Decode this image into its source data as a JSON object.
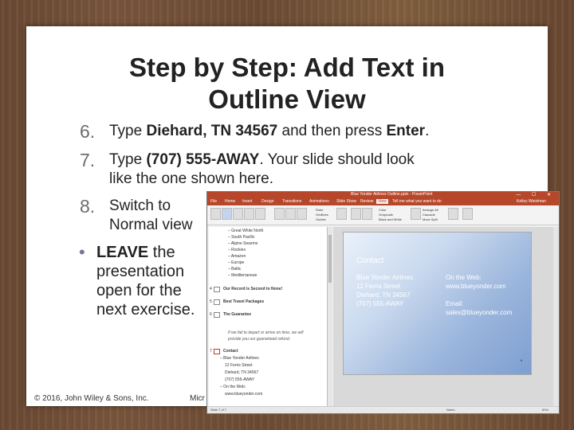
{
  "slide": {
    "title_line1": "Step by Step: Add Text in",
    "title_line2": "Outline View",
    "steps": [
      {
        "num": "6.",
        "pre": "Type ",
        "bold": "Diehard, TN 34567",
        "post": " and then press ",
        "bold2": "Enter",
        "end": "."
      },
      {
        "num": "7.",
        "pre": "Type ",
        "bold": "(707) 555-AWAY",
        "post": ". Your slide should look",
        "line2": "like the one shown here."
      },
      {
        "num": "8.",
        "line1": "Switch to",
        "line2": "Normal view"
      }
    ],
    "bullet": {
      "bold": "LEAVE",
      "rest1": " the",
      "line2": "presentation",
      "line3": "open for the",
      "line4": "next exercise."
    },
    "footer_left": "© 2016, John Wiley & Sons, Inc.",
    "footer_mid": "Micr"
  },
  "screenshot": {
    "file_name": "Blue Yonder Airlines Outline.pptx - PowerPoint",
    "window_buttons": "— ☐ ✕",
    "tabs": [
      "File",
      "Home",
      "Insert",
      "Design",
      "Transitions",
      "Animations",
      "Slide Show",
      "Review",
      "View"
    ],
    "active_tab": "View",
    "tell_me": "Tell me what you want to do",
    "sign_in": "Kelley Weixlman",
    "ribbon_labels": [
      "Normal",
      "Outline View",
      "Slide Sorter",
      "Notes Page",
      "Reading View",
      "Slide Master",
      "Handout Master",
      "Notes Master",
      "Ruler",
      "Gridlines",
      "Guides",
      "Notes",
      "Zoom",
      "Fit to Window",
      "Color",
      "Grayscale",
      "Black and White",
      "New Window",
      "Arrange All",
      "Cascade",
      "Move Split",
      "Switch Windows",
      "Macros"
    ],
    "outline_lines": [
      "– Great White North",
      "– South Pacific",
      "– Alpine Swarms",
      "– Rockies",
      "– Amazon",
      "– Europe",
      "– Baltic",
      "– Mediterranean"
    ],
    "outline_slides": [
      {
        "num": "4",
        "title": "Our Record is Second to None!"
      },
      {
        "num": "5",
        "title": "Best Travel Packages"
      },
      {
        "num": "6",
        "title": "The Guarantee"
      }
    ],
    "guarantee_text_1": "If we fail to depart or arrive on time, we will",
    "guarantee_text_2": "provide you our guaranteed refund.",
    "contact_num": "7",
    "contact_title": "Contact",
    "contact_lines": [
      "– Blue Yonder Airlines",
      "12 Ferris Street",
      "Diehard, TN 34567",
      "(707) 555-AWAY",
      "– On the Web:",
      "www.blueyonder.com"
    ],
    "thumb_slide": {
      "heading": "Contact",
      "left_lines": [
        "Blue Yonder Airlines",
        "12 Ferris Street",
        "Diehard, TN 34567",
        "(707) 555-AWAY"
      ],
      "right_heading": "On the Web:",
      "right_web": "www.blueyonder.com",
      "right_email_label": "Email:",
      "right_email": "sales@blueyonder.com",
      "slide_number": "6"
    },
    "status_left": "Slide 7 of 7",
    "status_notes": "Notes",
    "status_zoom": "60%"
  }
}
